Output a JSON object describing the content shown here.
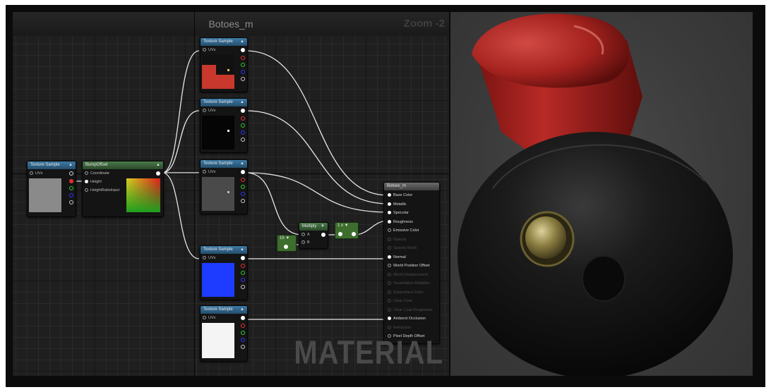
{
  "graph": {
    "title": "Botoes_m",
    "zoom": "Zoom -2",
    "watermark": "MATERIAL"
  },
  "texture_node_title": "Texture Sample",
  "uv_label": "UVs",
  "bump_node": {
    "title": "BumpOffset",
    "inputs": [
      "Coordinate",
      "Height",
      "HeightRatioInput"
    ]
  },
  "multiply_node": {
    "title": "Multiply",
    "inputs": [
      "A",
      "B"
    ]
  },
  "constants": {
    "left": "15",
    "right": "1 x"
  },
  "material_node": {
    "title": "Botoes_m",
    "pins": [
      {
        "label": "Base Color",
        "enabled": true
      },
      {
        "label": "Metallic",
        "enabled": true
      },
      {
        "label": "Specular",
        "enabled": true
      },
      {
        "label": "Roughness",
        "enabled": true
      },
      {
        "label": "Emissive Color",
        "enabled": true
      },
      {
        "label": "Opacity",
        "enabled": false
      },
      {
        "label": "Opacity Mask",
        "enabled": false
      },
      {
        "label": "Normal",
        "enabled": true
      },
      {
        "label": "World Position Offset",
        "enabled": true
      },
      {
        "label": "World Displacement",
        "enabled": false
      },
      {
        "label": "Tessellation Multiplier",
        "enabled": false
      },
      {
        "label": "Subsurface Color",
        "enabled": false
      },
      {
        "label": "Clear Coat",
        "enabled": false
      },
      {
        "label": "Clear Coat Roughness",
        "enabled": false
      },
      {
        "label": "Ambient Occlusion",
        "enabled": true
      },
      {
        "label": "Refraction",
        "enabled": false
      },
      {
        "label": "Pixel Depth Offset",
        "enabled": true
      }
    ]
  },
  "colors": {
    "texture_header": "#3d7ba6",
    "graph_background": "#1f1f1f",
    "wire": "#e6e6e6",
    "preview_red": "#c8382c",
    "preview_blue": "#1e3cff"
  }
}
